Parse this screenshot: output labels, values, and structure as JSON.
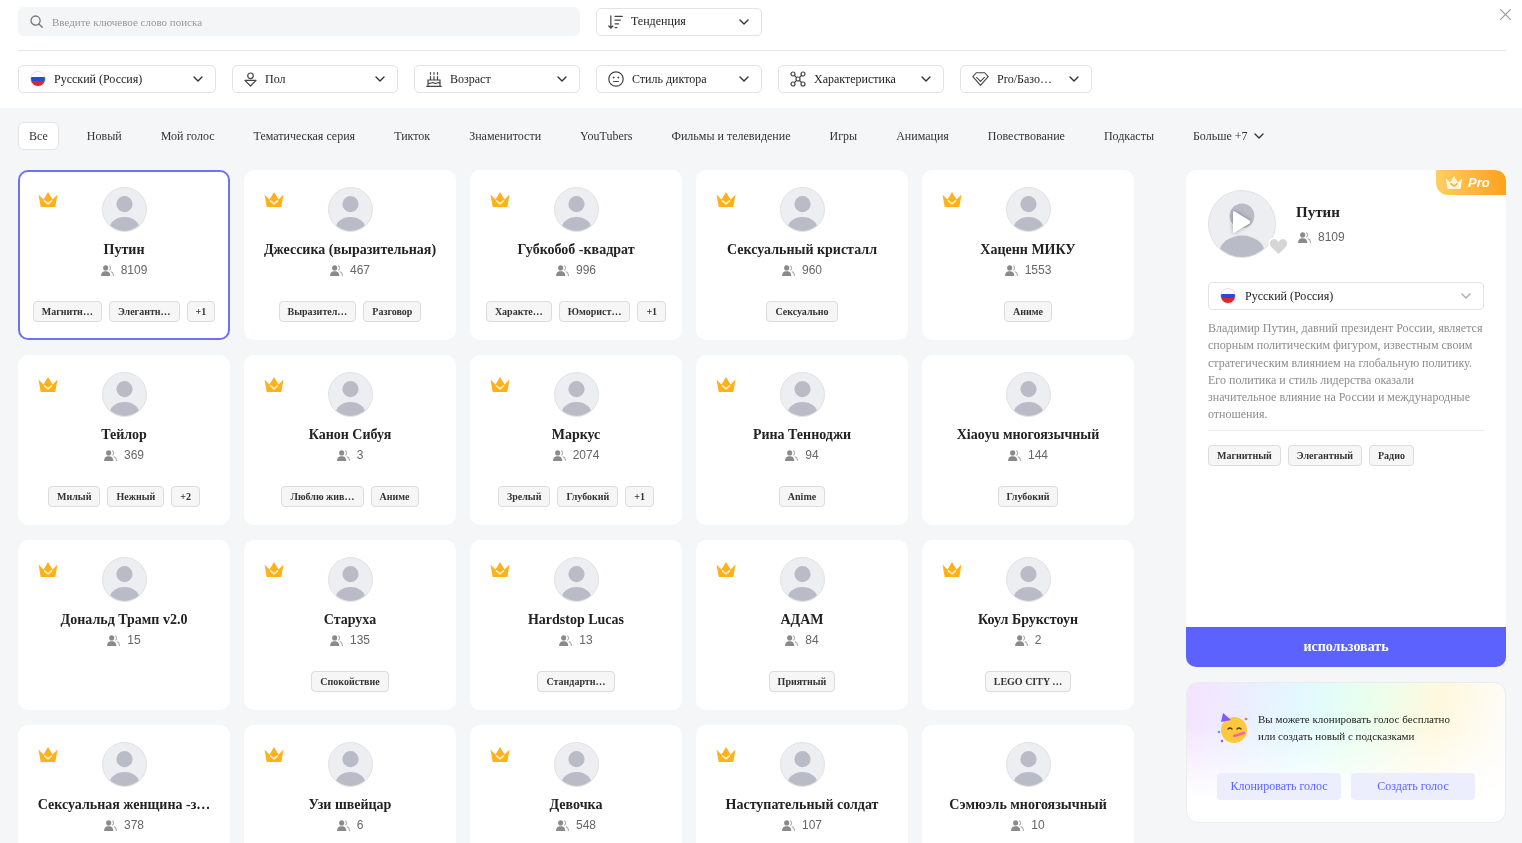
{
  "search": {
    "placeholder": "Введите ключевое слово поиска"
  },
  "sort": {
    "label": "Тенденция"
  },
  "filters": [
    {
      "kind": "language",
      "label": "Русский (Россия)"
    },
    {
      "kind": "gender",
      "label": "Пол"
    },
    {
      "kind": "age",
      "label": "Возраст"
    },
    {
      "kind": "style",
      "label": "Стиль диктора"
    },
    {
      "kind": "feature",
      "label": "Характеристика"
    },
    {
      "kind": "plan",
      "label": "Pro/Базо…"
    }
  ],
  "categories": [
    {
      "kind": "tab",
      "label": "Все",
      "selected": true
    },
    {
      "kind": "tab",
      "label": "Новый",
      "selected": false
    },
    {
      "kind": "tab",
      "label": "Мой голос",
      "selected": false
    },
    {
      "kind": "tab",
      "label": "Тематическая серия",
      "selected": false
    },
    {
      "kind": "tab",
      "label": "Тикток",
      "selected": false
    },
    {
      "kind": "tab",
      "label": "Знаменитости",
      "selected": false
    },
    {
      "kind": "tab",
      "label": "YouTubers",
      "selected": false
    },
    {
      "kind": "tab",
      "label": "Фильмы и телевидение",
      "selected": false
    },
    {
      "kind": "tab",
      "label": "Игры",
      "selected": false
    },
    {
      "kind": "tab",
      "label": "Анимация",
      "selected": false
    },
    {
      "kind": "tab",
      "label": "Повествование",
      "selected": false
    },
    {
      "kind": "tab",
      "label": "Подкасты",
      "selected": false
    },
    {
      "kind": "more",
      "label": "Больше +7",
      "selected": false
    }
  ],
  "voices": [
    {
      "name": "Путин",
      "users": "8109",
      "pro": true,
      "selected": true,
      "tags": [
        "Магнитн…",
        "Элегантн…",
        "+1"
      ]
    },
    {
      "name": "Джессика (выразительная)",
      "users": "467",
      "pro": true,
      "selected": false,
      "tags": [
        "Выразител…",
        "Разговор"
      ]
    },
    {
      "name": "Губкобоб -квадрат",
      "users": "996",
      "pro": true,
      "selected": false,
      "tags": [
        "Характе…",
        "Юморист…",
        "+1"
      ]
    },
    {
      "name": "Сексуальный кристалл",
      "users": "960",
      "pro": true,
      "selected": false,
      "tags": [
        "Сексуально"
      ]
    },
    {
      "name": "Хаценн МИКУ",
      "users": "1553",
      "pro": true,
      "selected": false,
      "tags": [
        "Аниме"
      ]
    },
    {
      "name": "Тейлор",
      "users": "369",
      "pro": true,
      "selected": false,
      "tags": [
        "Милый",
        "Нежный",
        "+2"
      ]
    },
    {
      "name": "Канон Сибуя",
      "users": "3",
      "pro": true,
      "selected": false,
      "tags": [
        "Люблю жив…",
        "Аниме"
      ]
    },
    {
      "name": "Маркус",
      "users": "2074",
      "pro": true,
      "selected": false,
      "tags": [
        "Зрелый",
        "Глубокий",
        "+1"
      ]
    },
    {
      "name": "Рина Тенноджи",
      "users": "94",
      "pro": true,
      "selected": false,
      "tags": [
        "Anime"
      ]
    },
    {
      "name": "Xiaoyu многоязычный",
      "users": "144",
      "pro": false,
      "selected": false,
      "tags": [
        "Глубокий"
      ]
    },
    {
      "name": "Дональд Трамп v2.0",
      "users": "15",
      "pro": true,
      "selected": false
    },
    {
      "name": "Старуха",
      "users": "135",
      "pro": true,
      "selected": false,
      "tags": [
        "Спокойствие"
      ]
    },
    {
      "name": "Hardstop Lucas",
      "users": "13",
      "pro": true,
      "selected": false,
      "tags": [
        "Стандартн…"
      ]
    },
    {
      "name": "АДАМ",
      "users": "84",
      "pro": true,
      "selected": false,
      "tags": [
        "Приятный"
      ]
    },
    {
      "name": "Коул Брукстоун",
      "users": "2",
      "pro": true,
      "selected": false,
      "tags": [
        "LEGO CITY …"
      ]
    },
    {
      "name": "Сексуальная женщина -з…",
      "users": "378",
      "pro": true,
      "selected": false
    },
    {
      "name": "Узи швейцар",
      "users": "6",
      "pro": true,
      "selected": false
    },
    {
      "name": "Девочка",
      "users": "548",
      "pro": true,
      "selected": false
    },
    {
      "name": "Наступательный солдат",
      "users": "107",
      "pro": true,
      "selected": false
    },
    {
      "name": "Сэмюэль многоязычный",
      "users": "10",
      "pro": false,
      "selected": false
    }
  ],
  "detail": {
    "badge": "Pro",
    "name": "Путин",
    "users": "8109",
    "language": "Русский (Россия)",
    "description": "Владимир Путин, давний президент России, является спорным политическим фигуром, известным своим стратегическим влиянием на глобальную политику. Его политика и стиль лидерства оказали значительное влияние на России и международные отношения.",
    "tags": [
      "Магнитный",
      "Элегантный",
      "Радио"
    ],
    "use_button": "использовать"
  },
  "promo": {
    "text": "Вы можете клонировать голос бесплатно или создать новый с подсказками",
    "clone_button": "Клонировать голос",
    "create_button": "Создать голос"
  }
}
